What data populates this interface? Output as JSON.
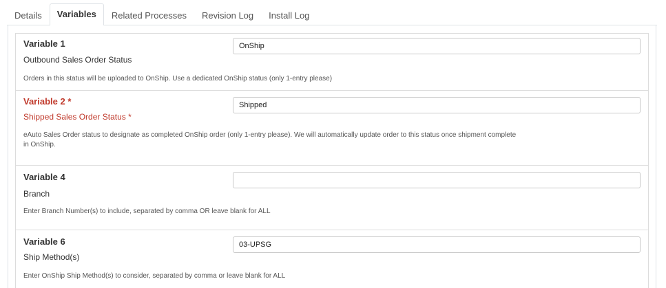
{
  "tabs": [
    {
      "label": "Details",
      "active": false
    },
    {
      "label": "Variables",
      "active": true
    },
    {
      "label": "Related Processes",
      "active": false
    },
    {
      "label": "Revision Log",
      "active": false
    },
    {
      "label": "Install Log",
      "active": false
    }
  ],
  "variables": [
    {
      "title": "Variable 1",
      "name": "Outbound Sales Order Status",
      "value": "OnShip",
      "description": "Orders in this status will be uploaded to OnShip. Use a dedicated OnShip status (only 1-entry please)",
      "required": false
    },
    {
      "title": "Variable 2 *",
      "name": "Shipped Sales Order Status *",
      "value": "Shipped",
      "description": "eAuto Sales Order status to designate as completed OnShip order (only 1-entry please). We will automatically update order to this status once shipment complete in OnShip.",
      "required": true
    },
    {
      "title": "Variable 4",
      "name": "Branch",
      "value": "",
      "description": "Enter Branch Number(s) to include, separated by comma OR leave blank for ALL",
      "required": false
    },
    {
      "title": "Variable 6",
      "name": "Ship Method(s)",
      "value": "03-UPSG",
      "description": "Enter OnShip Ship Method(s) to consider, separated by comma or leave blank for ALL",
      "required": false
    }
  ],
  "colors": {
    "required": "#c0392b",
    "border": "#dcdcdc",
    "text": "#333333"
  }
}
